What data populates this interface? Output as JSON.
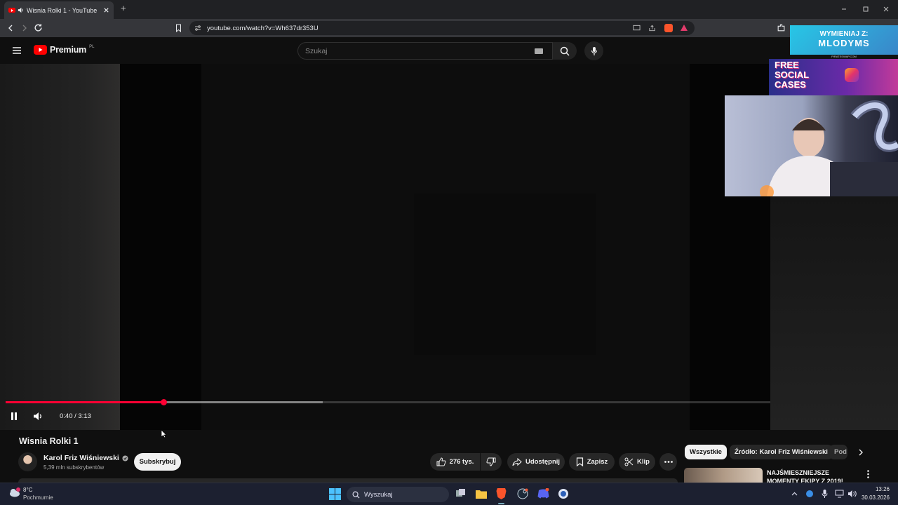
{
  "browser": {
    "tab_title": "Wisnia Rolki 1 - YouTube",
    "new_tab": "+",
    "url": "youtube.com/watch?v=Wh637dr353U"
  },
  "youtube": {
    "logo_text": "Premium",
    "logo_region": "PL",
    "search_placeholder": "Szukaj"
  },
  "ad": {
    "line1": "WYMIENIAJ Z:",
    "line2": "MLODYMS",
    "site": "PIRATESWAP.COM",
    "free": "FREE",
    "social": "SOCIAL",
    "cases": "CASES"
  },
  "player": {
    "time": "0:40 / 3:13",
    "progress": 0.207,
    "buffered": 0.415
  },
  "video": {
    "title": "Wisnia Rolki 1",
    "channel": "Karol Friz Wiśniewski",
    "subscribers": "5,39 mln subskrybentów",
    "subscribe": "Subskrybuj",
    "likes": "276 tys.",
    "share": "Udostępnij",
    "save": "Zapisz",
    "clip": "Klip"
  },
  "chips": {
    "all": "Wszystkie",
    "source": "Źródło: Karol Friz Wiśniewski",
    "partial": "Pod"
  },
  "recommendation": {
    "line1": "NAJŚMIESZNIEJSZE",
    "line2": "MOMENTY EKIPY Z 2019!"
  },
  "taskbar": {
    "temp": "8°C",
    "weather": "Pochmurnie",
    "search": "Wyszukaj",
    "time": "13:26",
    "date": "30.03.2026"
  },
  "colors": {
    "progress": "#ff0033",
    "youtube_red": "#ff0000",
    "background": "#0f0f0f"
  }
}
